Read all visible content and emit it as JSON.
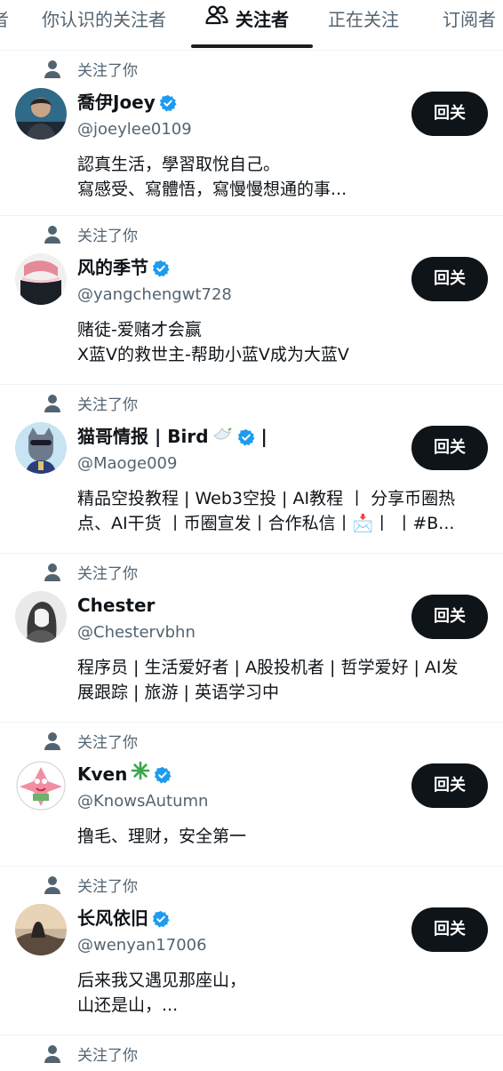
{
  "tabs": [
    {
      "label": "者"
    },
    {
      "label": "你认识的关注者"
    },
    {
      "label": "关注者"
    },
    {
      "label": "正在关注"
    },
    {
      "label": "订阅者"
    }
  ],
  "followers": [
    {
      "followed_label": "关注了你",
      "name": "喬伊Joey",
      "handle": "@joeylee0109",
      "bio": [
        "認真生活，學習取悅自己。",
        "寫感受、寫體悟，寫慢慢想通的事..."
      ],
      "button": "回关"
    },
    {
      "followed_label": "关注了你",
      "name": "风的季节",
      "handle": "@yangchengwt728",
      "bio": [
        "赌徒-爱赌才会赢",
        "X蓝V的救世主-帮助小蓝V成为大蓝V"
      ],
      "button": "回关"
    },
    {
      "followed_label": "关注了你",
      "name": "猫哥情报 | Bird",
      "name_suffix": "|",
      "handle": "@Maoge009",
      "bio": [
        "精品空投教程 | Web3空投 | AI教程 丨 分享币圈热",
        "点、AI干货 丨币圈宣发丨合作私信丨📩丨 丨#B..."
      ],
      "button": "回关"
    },
    {
      "followed_label": "关注了你",
      "name": "Chester",
      "handle": "@Chestervbhn",
      "bio": [
        "程序员 | 生活爱好者 | A股投机者 | 哲学爱好 | AI发",
        "展跟踪 | 旅游 | 英语学习中"
      ],
      "button": "回关"
    },
    {
      "followed_label": "关注了你",
      "name": "Kven",
      "handle": "@KnowsAutumn",
      "bio": [
        "撸毛、理财，安全第一"
      ],
      "button": "回关"
    },
    {
      "followed_label": "关注了你",
      "name": "长风依旧",
      "handle": "@wenyan17006",
      "bio": [
        "后来我又遇见那座山，",
        "山还是山，..."
      ],
      "button": "回关"
    },
    {
      "followed_label": "关注了你"
    }
  ],
  "colors": {
    "accent": "#1d9bf0",
    "text": "#0f1419",
    "secondary": "#536471",
    "button_bg": "#0f1419"
  }
}
